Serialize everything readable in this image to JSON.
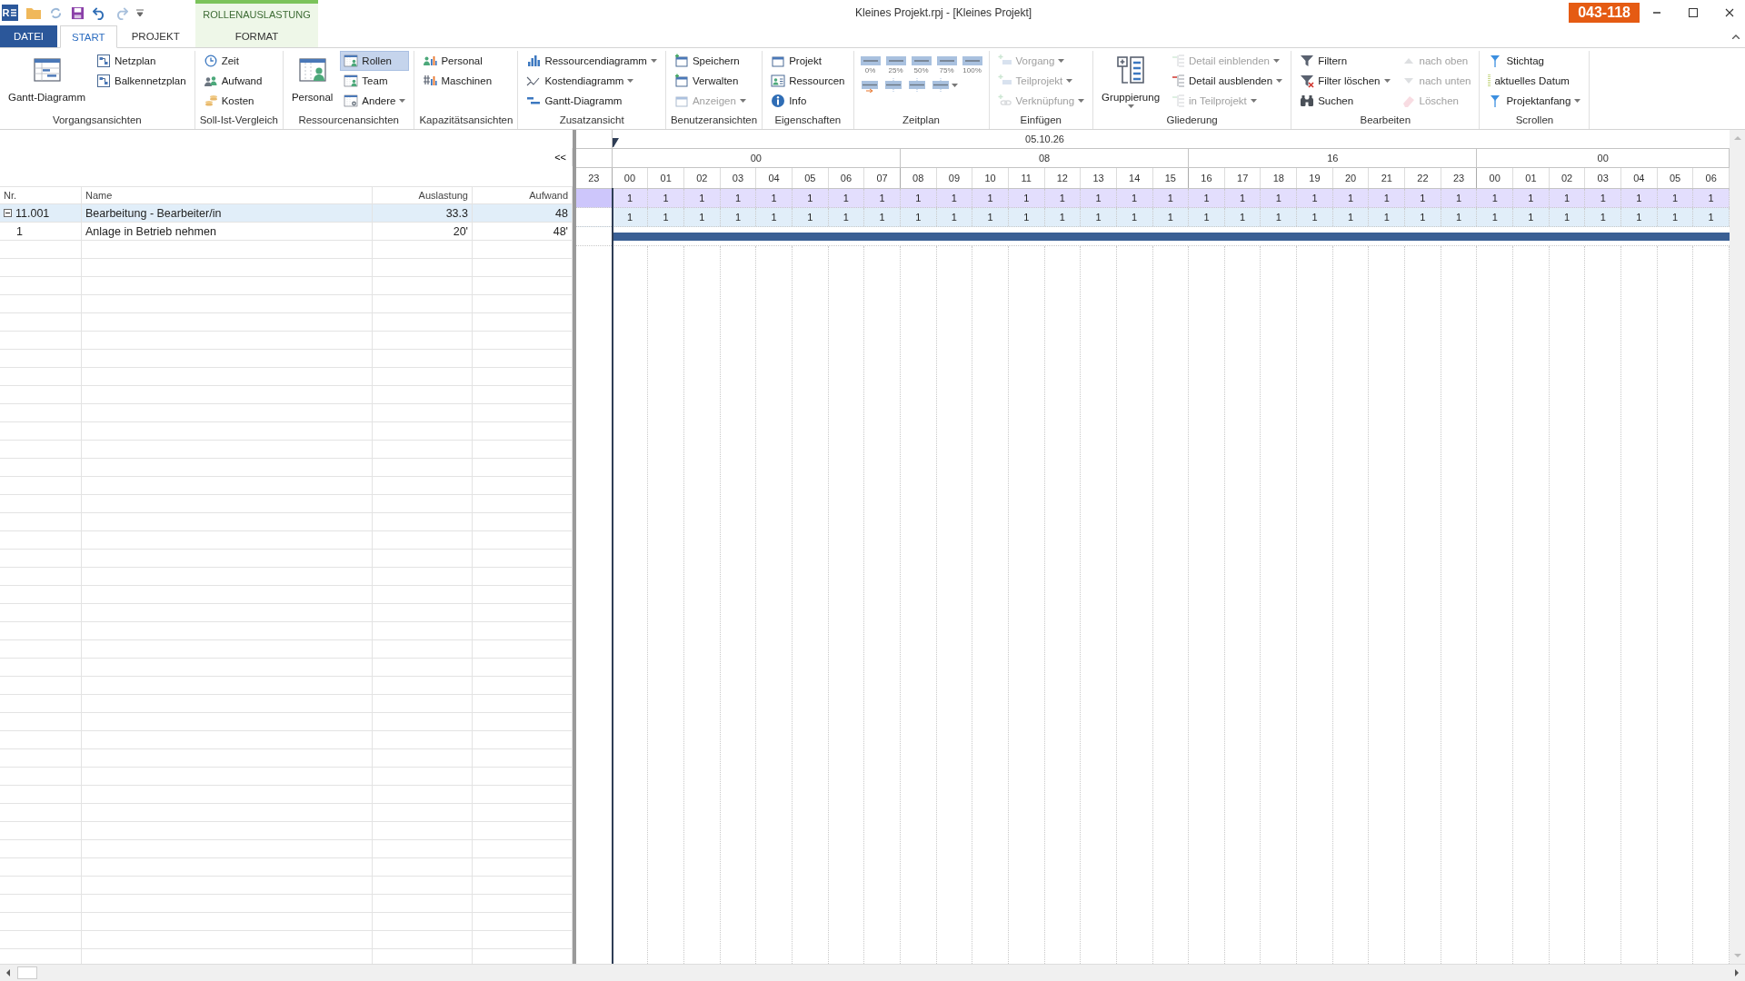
{
  "titlebar": {
    "app_logo": "R",
    "title": "Kleines Projekt.rpj - [Kleines Projekt]",
    "badge": "043-118",
    "context_label": "ROLLENAUSLASTUNG"
  },
  "tabs": [
    {
      "label": "DATEI",
      "kind": "file",
      "selected": false
    },
    {
      "label": "START",
      "kind": "normal",
      "selected": true
    },
    {
      "label": "PROJEKT",
      "kind": "normal",
      "selected": false
    },
    {
      "label": "FORMAT",
      "kind": "context",
      "selected": false
    }
  ],
  "ribbon": {
    "groups": [
      {
        "label": "Vorgangsansichten",
        "kind": "buttons",
        "columns": [
          [
            {
              "label": "Gantt-Diagramm",
              "kind": "large",
              "selected": false,
              "disabled": false,
              "dropdown": false
            }
          ],
          [
            {
              "label": "Netzplan",
              "kind": "small",
              "selected": false,
              "disabled": false,
              "dropdown": false
            },
            {
              "label": "Balkennetzplan",
              "kind": "small",
              "selected": false,
              "disabled": false,
              "dropdown": false
            }
          ]
        ]
      },
      {
        "label": "Soll-Ist-Vergleich",
        "kind": "buttons",
        "columns": [
          [
            {
              "label": "Zeit",
              "kind": "small",
              "selected": false,
              "disabled": false,
              "dropdown": false
            },
            {
              "label": "Aufwand",
              "kind": "small",
              "selected": false,
              "disabled": false,
              "dropdown": false
            },
            {
              "label": "Kosten",
              "kind": "small",
              "selected": false,
              "disabled": false,
              "dropdown": false
            }
          ]
        ]
      },
      {
        "label": "Ressourcenansichten",
        "kind": "buttons",
        "columns": [
          [
            {
              "label": "Personal",
              "kind": "large",
              "selected": false,
              "disabled": false,
              "dropdown": false
            }
          ],
          [
            {
              "label": "Rollen",
              "kind": "small",
              "selected": true,
              "disabled": false,
              "dropdown": false
            },
            {
              "label": "Team",
              "kind": "small",
              "selected": false,
              "disabled": false,
              "dropdown": false
            },
            {
              "label": "Andere",
              "kind": "small",
              "selected": false,
              "disabled": false,
              "dropdown": true
            }
          ]
        ]
      },
      {
        "label": "Kapazitätsansichten",
        "kind": "buttons",
        "columns": [
          [
            {
              "label": "Personal",
              "kind": "small",
              "selected": false,
              "disabled": false,
              "dropdown": false
            },
            {
              "label": "Maschinen",
              "kind": "small",
              "selected": false,
              "disabled": false,
              "dropdown": false
            }
          ]
        ]
      },
      {
        "label": "Zusatzansicht",
        "kind": "buttons",
        "columns": [
          [
            {
              "label": "Ressourcendiagramm",
              "kind": "small",
              "selected": false,
              "disabled": false,
              "dropdown": true
            },
            {
              "label": "Kostendiagramm",
              "kind": "small",
              "selected": false,
              "disabled": false,
              "dropdown": true
            },
            {
              "label": "Gantt-Diagramm",
              "kind": "small",
              "selected": false,
              "disabled": false,
              "dropdown": false
            }
          ]
        ]
      },
      {
        "label": "Benutzeransichten",
        "kind": "buttons",
        "columns": [
          [
            {
              "label": "Speichern",
              "kind": "small",
              "selected": false,
              "disabled": false,
              "dropdown": false
            },
            {
              "label": "Verwalten",
              "kind": "small",
              "selected": false,
              "disabled": false,
              "dropdown": false
            },
            {
              "label": "Anzeigen",
              "kind": "small",
              "selected": false,
              "disabled": true,
              "dropdown": true
            }
          ]
        ]
      },
      {
        "label": "Eigenschaften",
        "kind": "buttons",
        "columns": [
          [
            {
              "label": "Projekt",
              "kind": "small",
              "selected": false,
              "disabled": false,
              "dropdown": false
            },
            {
              "label": "Ressourcen",
              "kind": "small",
              "selected": false,
              "disabled": false,
              "dropdown": false
            },
            {
              "label": "Info",
              "kind": "small",
              "selected": false,
              "disabled": false,
              "dropdown": false
            }
          ]
        ]
      },
      {
        "label": "Zeitplan",
        "kind": "zoom",
        "zoom_levels": [
          {
            "label": "0%"
          },
          {
            "label": "25%"
          },
          {
            "label": "50%"
          },
          {
            "label": "75%"
          },
          {
            "label": "100%"
          }
        ],
        "tools": [
          {
            "dropdown": false
          },
          {
            "dropdown": false
          },
          {
            "dropdown": false
          },
          {
            "dropdown": true
          }
        ]
      },
      {
        "label": "Einfügen",
        "kind": "buttons",
        "columns": [
          [
            {
              "label": "Vorgang",
              "kind": "small",
              "selected": false,
              "disabled": true,
              "dropdown": true
            },
            {
              "label": "Teilprojekt",
              "kind": "small",
              "selected": false,
              "disabled": true,
              "dropdown": true
            },
            {
              "label": "Verknüpfung",
              "kind": "small",
              "selected": false,
              "disabled": true,
              "dropdown": true
            }
          ]
        ]
      },
      {
        "label": "Gliederung",
        "kind": "buttons",
        "columns": [
          [
            {
              "label": "Gruppierung",
              "kind": "large",
              "selected": false,
              "disabled": false,
              "dropdown": true
            }
          ],
          [
            {
              "label": "Detail einblenden",
              "kind": "small",
              "selected": false,
              "disabled": true,
              "dropdown": true
            },
            {
              "label": "Detail ausblenden",
              "kind": "small",
              "selected": false,
              "disabled": false,
              "dropdown": true
            },
            {
              "label": "in Teilprojekt",
              "kind": "small",
              "selected": false,
              "disabled": true,
              "dropdown": true
            }
          ]
        ]
      },
      {
        "label": "Bearbeiten",
        "kind": "buttons",
        "columns": [
          [
            {
              "label": "Filtern",
              "kind": "small",
              "selected": false,
              "disabled": false,
              "dropdown": false
            },
            {
              "label": "Filter löschen",
              "kind": "small",
              "selected": false,
              "disabled": false,
              "dropdown": true
            },
            {
              "label": "Suchen",
              "kind": "small",
              "selected": false,
              "disabled": false,
              "dropdown": false
            }
          ],
          [
            {
              "label": "nach oben",
              "kind": "small",
              "selected": false,
              "disabled": true,
              "dropdown": false
            },
            {
              "label": "nach unten",
              "kind": "small",
              "selected": false,
              "disabled": true,
              "dropdown": false
            },
            {
              "label": "Löschen",
              "kind": "small",
              "selected": false,
              "disabled": true,
              "dropdown": false
            }
          ]
        ]
      },
      {
        "label": "Scrollen",
        "kind": "buttons",
        "columns": [
          [
            {
              "label": "Stichtag",
              "kind": "small",
              "selected": false,
              "disabled": false,
              "dropdown": false
            },
            {
              "label": "aktuelles Datum",
              "kind": "small",
              "selected": false,
              "disabled": false,
              "dropdown": false
            },
            {
              "label": "Projektanfang",
              "kind": "small",
              "selected": false,
              "disabled": false,
              "dropdown": true
            }
          ]
        ]
      }
    ]
  },
  "collapse_label": "<<",
  "table": {
    "columns": [
      "Nr.",
      "Name",
      "Auslastung",
      "Aufwand"
    ],
    "rows": [
      {
        "nr": "11.001",
        "name": "Bearbeitung - Bearbeiter/in",
        "auslastung": "33.3",
        "aufwand": "48",
        "expanded": true,
        "selected": true,
        "children": [
          {
            "nr": "1",
            "name": "Anlage in Betrieb nehmen",
            "auslastung": "20'",
            "aufwand": "48'",
            "selected": false
          }
        ]
      }
    ]
  },
  "timeline": {
    "date": "05.10.26",
    "groups": [
      "00",
      "08",
      "16",
      "00"
    ],
    "hours": [
      "23",
      "00",
      "01",
      "02",
      "03",
      "04",
      "05",
      "06",
      "07",
      "08",
      "09",
      "10",
      "11",
      "12",
      "13",
      "14",
      "15",
      "16",
      "17",
      "18",
      "19",
      "20",
      "21",
      "22",
      "23",
      "00",
      "01",
      "02",
      "03",
      "04",
      "05",
      "06"
    ],
    "load_rows": [
      {
        "kind": "total",
        "values": [
          "1",
          "1",
          "1",
          "1",
          "1",
          "1",
          "1",
          "1",
          "1",
          "1",
          "1",
          "1",
          "1",
          "1",
          "1",
          "1",
          "1",
          "1",
          "1",
          "1",
          "1",
          "1",
          "1",
          "1",
          "1",
          "1",
          "1",
          "1",
          "1",
          "1",
          "1"
        ]
      },
      {
        "kind": "role",
        "values": [
          "1",
          "1",
          "1",
          "1",
          "1",
          "1",
          "1",
          "1",
          "1",
          "1",
          "1",
          "1",
          "1",
          "1",
          "1",
          "1",
          "1",
          "1",
          "1",
          "1",
          "1",
          "1",
          "1",
          "1",
          "1",
          "1",
          "1",
          "1",
          "1",
          "1",
          "1"
        ]
      }
    ]
  }
}
